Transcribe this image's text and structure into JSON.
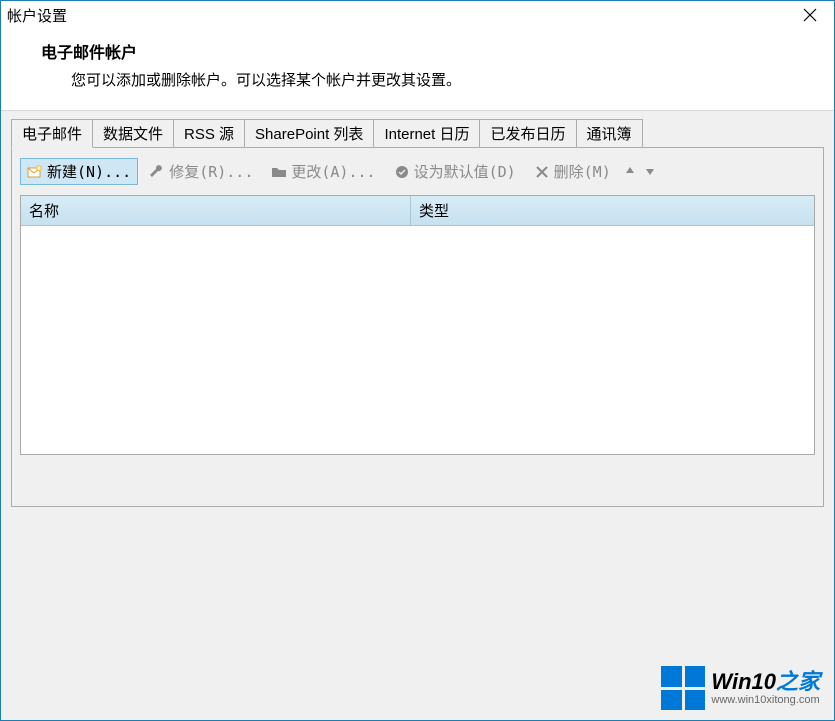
{
  "window": {
    "title": "帐户设置"
  },
  "header": {
    "title": "电子邮件帐户",
    "description": "您可以添加或删除帐户。可以选择某个帐户并更改其设置。"
  },
  "tabs": [
    {
      "label": "电子邮件",
      "active": true
    },
    {
      "label": "数据文件",
      "active": false
    },
    {
      "label": "RSS 源",
      "active": false
    },
    {
      "label": "SharePoint 列表",
      "active": false
    },
    {
      "label": "Internet 日历",
      "active": false
    },
    {
      "label": "已发布日历",
      "active": false
    },
    {
      "label": "通讯簿",
      "active": false
    }
  ],
  "toolbar": {
    "new": "新建(N)...",
    "repair": "修复(R)...",
    "change": "更改(A)...",
    "set_default": "设为默认值(D)",
    "delete": "删除(M)"
  },
  "list": {
    "columns": {
      "name": "名称",
      "type": "类型"
    }
  },
  "watermark": {
    "brand_prefix": "Win10",
    "brand_suffix": "之家",
    "url": "www.win10xitong.com"
  }
}
